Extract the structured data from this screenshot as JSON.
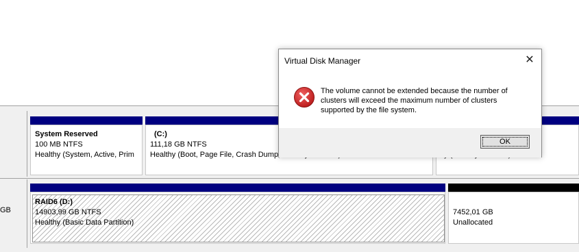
{
  "disk0": {
    "label_fragment": "",
    "partitions": [
      {
        "title": "System Reserved",
        "size": "100 MB NTFS",
        "status": "Healthy (System, Active, Prim"
      },
      {
        "title": "(C:)",
        "size": "111,18 GB NTFS",
        "status": "Healthy (Boot, Page File, Crash Dump, Primary Partition)"
      }
    ],
    "right_fragment": "thy (Primary Partition)"
  },
  "disk1": {
    "label_fragment": "GB",
    "partitions": [
      {
        "title": "RAID6  (D:)",
        "size": "14903,99 GB NTFS",
        "status": "Healthy (Basic Data Partition)"
      },
      {
        "title": "",
        "size": "7452,01 GB",
        "status": "Unallocated"
      }
    ]
  },
  "dialog": {
    "title": "Virtual Disk Manager",
    "close_symbol": "✕",
    "icon": "error-icon",
    "message": "The volume cannot be extended because the number of clusters will exceed the maximum number of clusters supported by the file system.",
    "ok_label": "OK"
  },
  "colors": {
    "primary_bar": "#000080",
    "unallocated_bar": "#000000",
    "error_red": "#d42c2c"
  }
}
